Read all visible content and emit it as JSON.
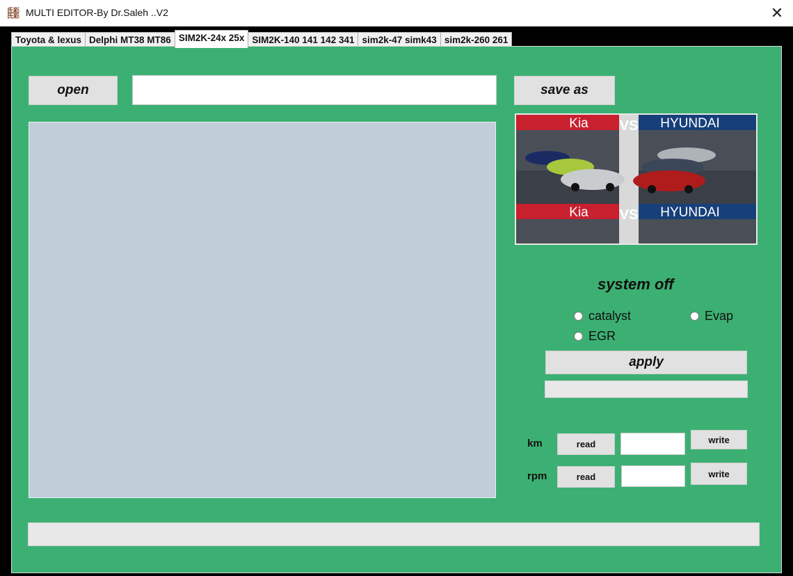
{
  "window": {
    "title": "MULTI EDITOR-By Dr.Saleh ..V2",
    "icon_text": "氏彩\n氏彩"
  },
  "tabs": [
    {
      "label": "Toyota & lexus",
      "active": false
    },
    {
      "label": "Delphi MT38 MT86",
      "active": false
    },
    {
      "label": "SIM2K-24x 25x",
      "active": true
    },
    {
      "label": "SIM2K-140 141 142 341",
      "active": false
    },
    {
      "label": "sim2k-47 simk43",
      "active": false
    },
    {
      "label": "sim2k-260 261",
      "active": false
    }
  ],
  "toolbar": {
    "open_label": "open",
    "path_value": "",
    "save_as_label": "save as"
  },
  "banner": {
    "left_brand": "Kia",
    "vs": "VS",
    "right_brand": "HYUNDAI",
    "colors": {
      "kia_red": "#c8202f",
      "hyundai_blue": "#17407a"
    }
  },
  "system_off": {
    "title": "system off",
    "options": [
      {
        "label": "catalyst",
        "checked": false
      },
      {
        "label": "Evap",
        "checked": false
      },
      {
        "label": "EGR",
        "checked": false
      }
    ],
    "apply_label": "apply",
    "status_value": ""
  },
  "counters": {
    "km": {
      "label": "km",
      "read_label": "read",
      "value": "",
      "write_label": "write"
    },
    "rpm": {
      "label": "rpm",
      "read_label": "read",
      "value": "",
      "write_label": "write"
    }
  },
  "status_bar": {
    "value": ""
  },
  "colors": {
    "panel_green": "#3cb072",
    "editor_bg": "#c1ceda"
  }
}
